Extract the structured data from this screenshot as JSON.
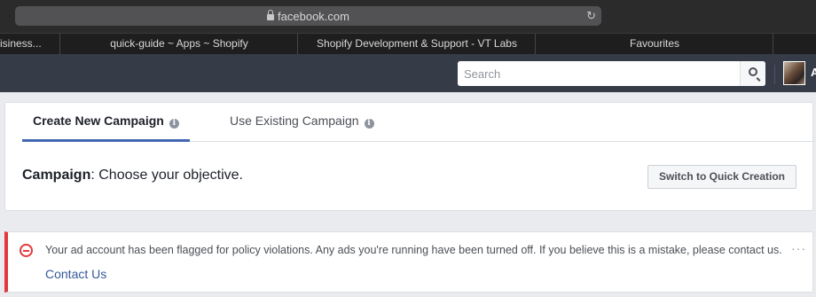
{
  "browser": {
    "url": "facebook.com",
    "reload_icon": "reload-icon",
    "lock_icon": "lock-icon"
  },
  "bookmarks": [
    {
      "label": "isiness..."
    },
    {
      "label": "quick-guide ~ Apps ~ Shopify"
    },
    {
      "label": "Shopify Development & Support - VT Labs"
    },
    {
      "label": "Favourites"
    }
  ],
  "header": {
    "search_placeholder": "Search",
    "search_icon": "search-icon",
    "user_initial": "A",
    "bar_color": "#353b47"
  },
  "campaign_card": {
    "tabs": [
      {
        "label": "Create New Campaign",
        "active": true
      },
      {
        "label": "Use Existing Campaign",
        "active": false
      }
    ],
    "info_glyph": "i",
    "objective_label": "Campaign",
    "objective_text": ": Choose your objective.",
    "quick_creation_button": "Switch to Quick Creation",
    "accent_color": "#4267b2"
  },
  "alert": {
    "message": "Your ad account has been flagged for policy violations. Any ads you're running have been turned off. If you believe this is a mistake, please contact us.",
    "link": "Contact Us",
    "more": "···",
    "color": "#e0393e"
  }
}
